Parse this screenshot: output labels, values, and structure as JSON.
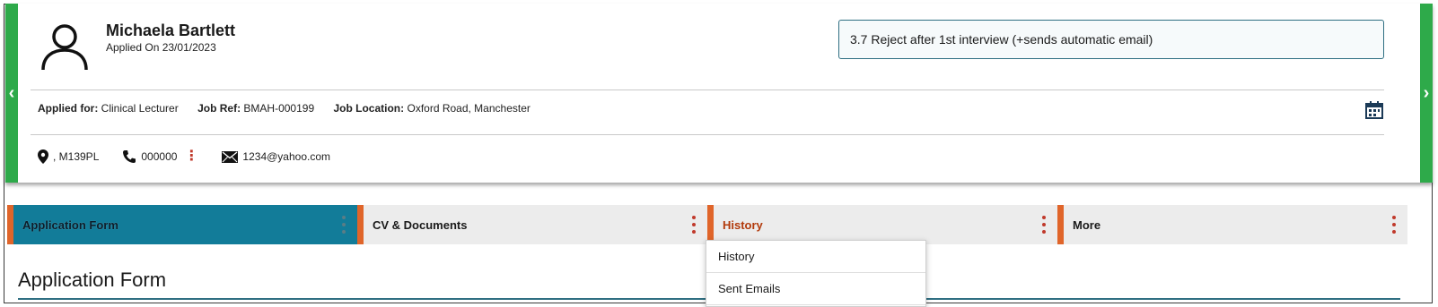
{
  "candidate": {
    "name": "Michaela Bartlett",
    "applied_on": "Applied On 23/01/2023",
    "status": "3.7 Reject after 1st interview (+sends automatic email)"
  },
  "job": {
    "applied_for_label": "Applied for:",
    "applied_for": "Clinical Lecturer",
    "job_ref_label": "Job Ref:",
    "job_ref": "BMAH-000199",
    "job_location_label": "Job Location:",
    "job_location": "Oxford Road, Manchester"
  },
  "contact": {
    "postcode": ", M139PL",
    "phone": "000000",
    "email": "1234@yahoo.com"
  },
  "tabs": [
    {
      "label": "Application Form"
    },
    {
      "label": "CV & Documents"
    },
    {
      "label": "History"
    },
    {
      "label": "More"
    }
  ],
  "dropdown": {
    "items": [
      {
        "label": "History"
      },
      {
        "label": "Sent Emails"
      }
    ]
  },
  "section": {
    "title": "Application Form"
  },
  "colors": {
    "accent_green": "#2eaa4a",
    "tab_active": "#127c99",
    "tab_marker": "#e0652a",
    "kebab": "#c0392b"
  },
  "icons": {
    "avatar": "user-outline-icon",
    "calendar": "calendar-icon",
    "location": "map-pin-icon",
    "phone": "phone-icon",
    "email": "envelope-icon"
  }
}
